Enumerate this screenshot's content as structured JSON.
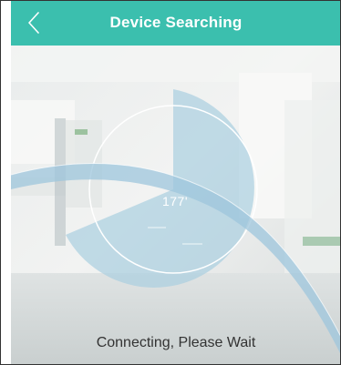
{
  "header": {
    "title": "Device Searching",
    "back_icon": "chevron-left-icon",
    "background_color": "#3bbfae",
    "text_color": "#ffffff"
  },
  "radar": {
    "angle_readout": "177'",
    "sweep_color": "#a9cfe0",
    "ring_color": "#ffffff",
    "progress_angle_degrees": 177
  },
  "status": {
    "message": "Connecting, Please Wait"
  }
}
